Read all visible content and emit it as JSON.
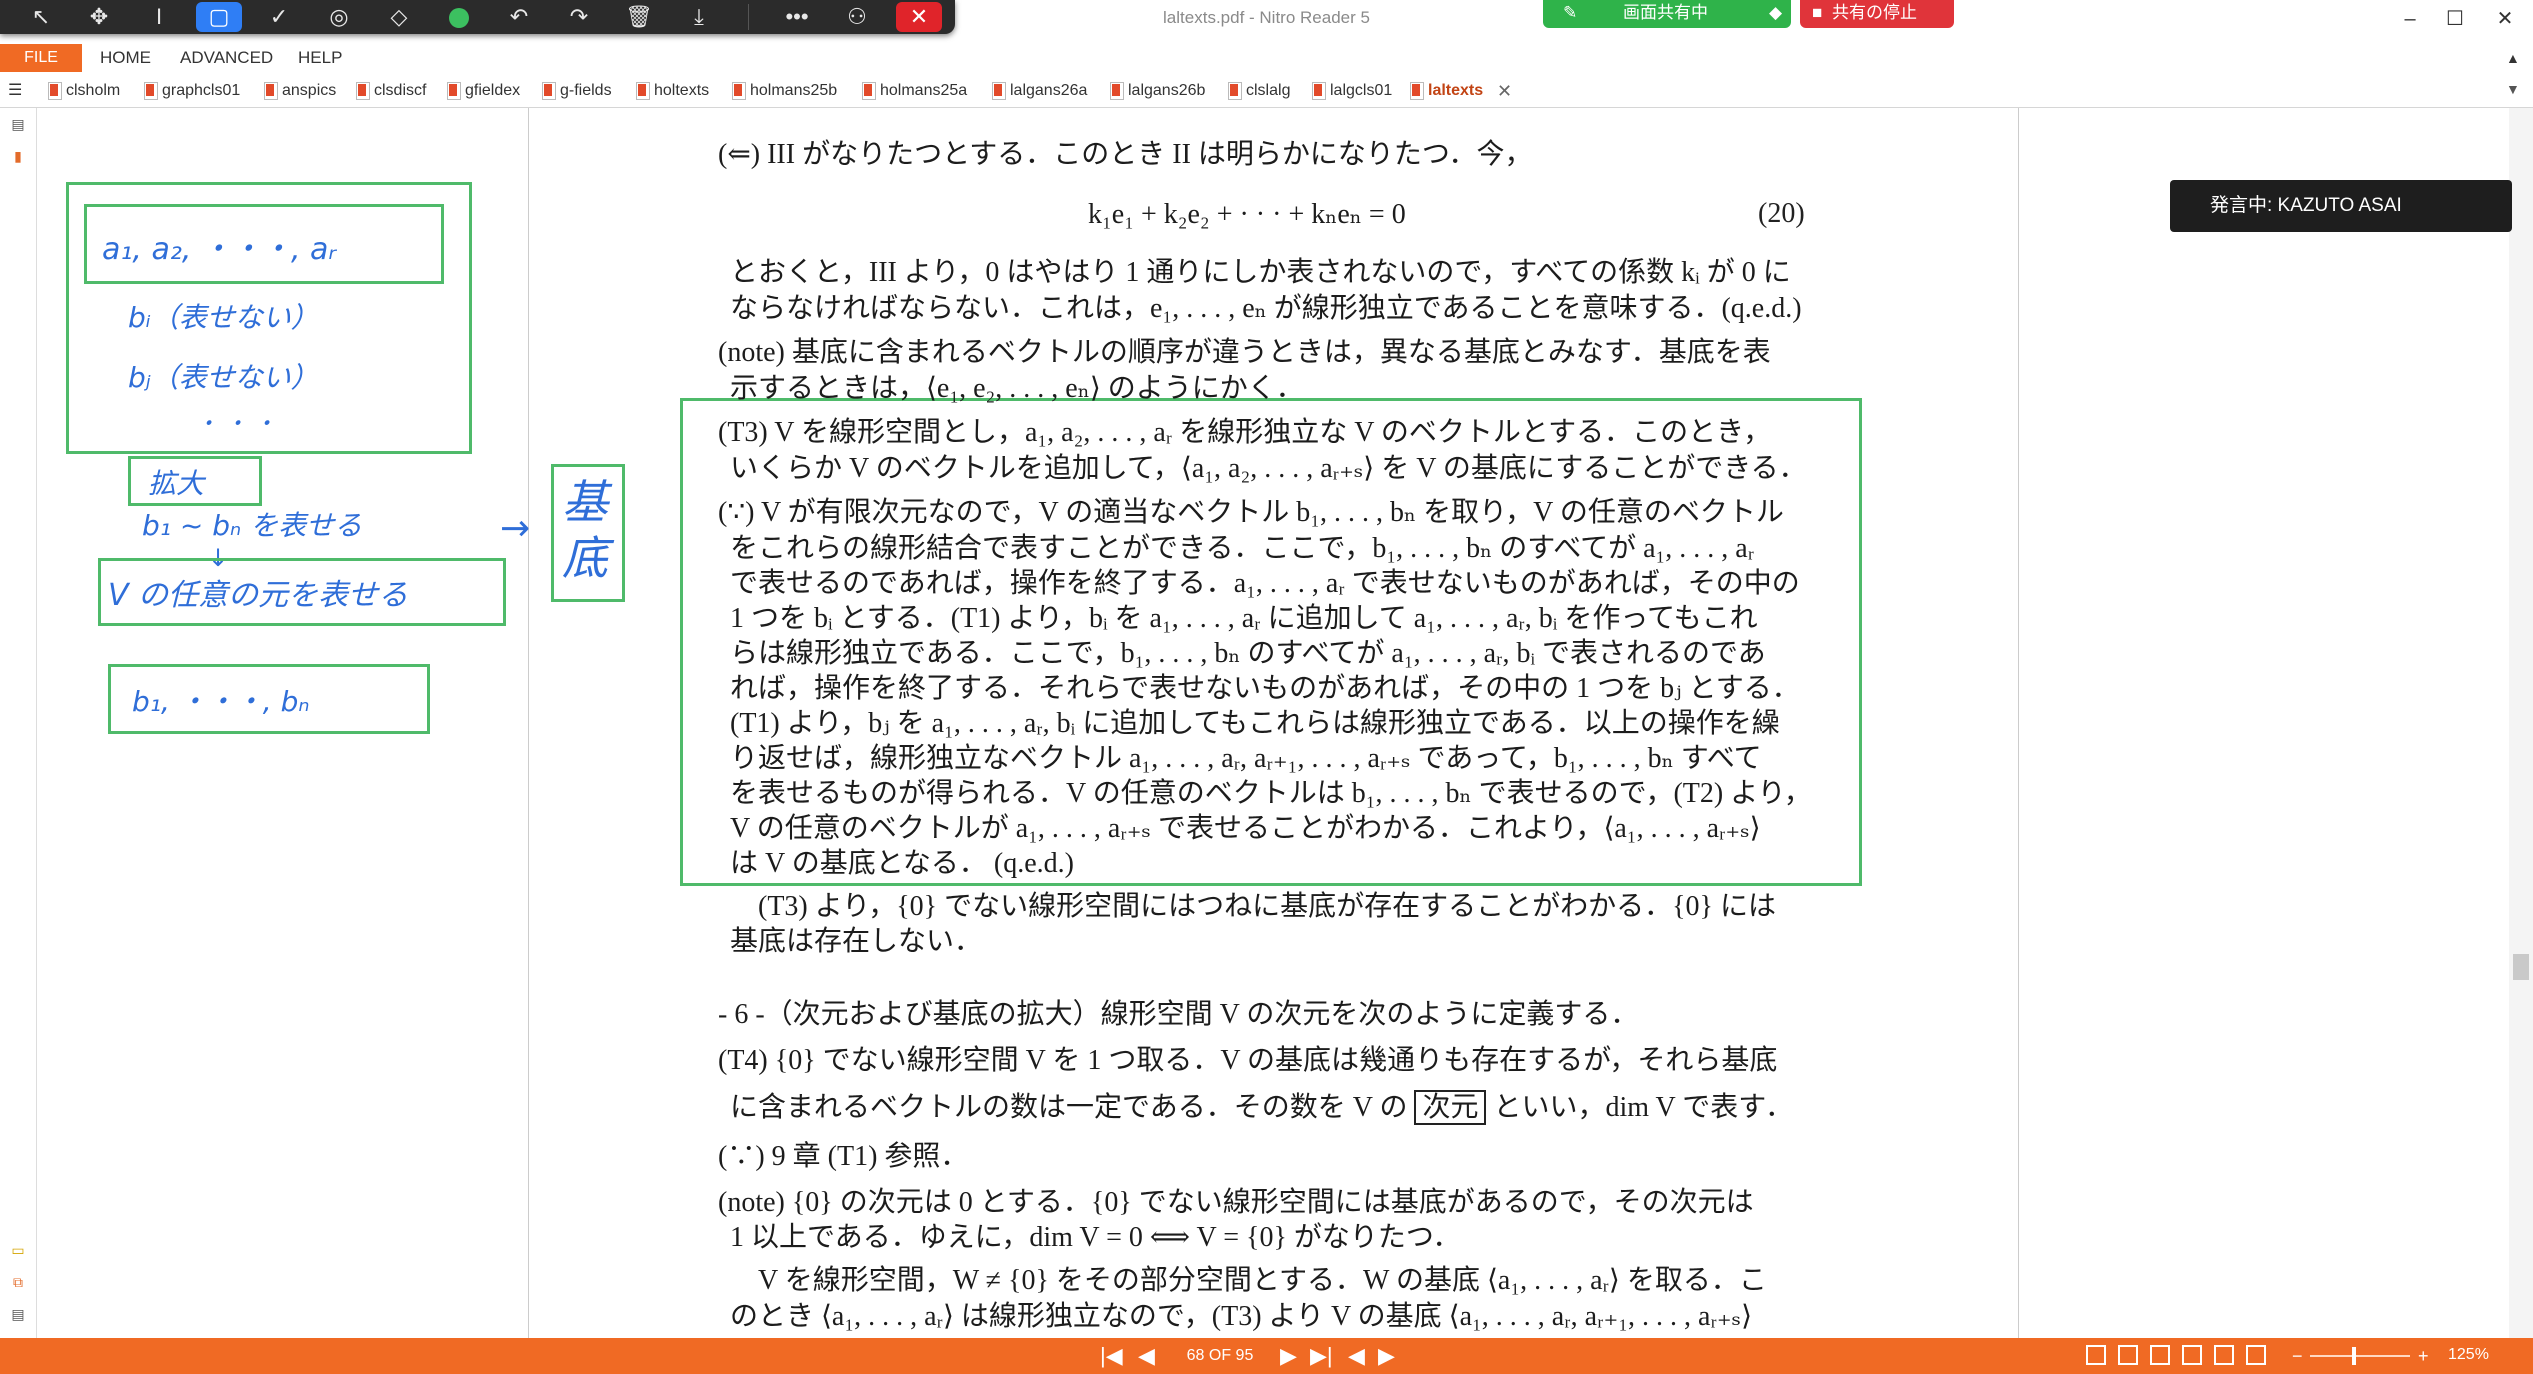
{
  "window": {
    "title": "laltexts.pdf - Nitro Reader 5",
    "controls": [
      "–",
      "☐",
      "✕"
    ]
  },
  "annotation_toolbar": {
    "tools": [
      {
        "name": "pointer-tool",
        "glyph": "↖"
      },
      {
        "name": "move-tool",
        "glyph": "✥"
      },
      {
        "name": "text-tool",
        "glyph": "I"
      },
      {
        "name": "rectangle-tool",
        "glyph": "▢"
      },
      {
        "name": "check-tool",
        "glyph": "✓"
      },
      {
        "name": "stamp-tool",
        "glyph": "◎"
      },
      {
        "name": "eraser-tool",
        "glyph": "◇"
      },
      {
        "name": "color-tool",
        "glyph": ""
      },
      {
        "name": "undo-tool",
        "glyph": "↶"
      },
      {
        "name": "redo-tool",
        "glyph": "↷"
      },
      {
        "name": "delete-tool",
        "glyph": "🗑"
      },
      {
        "name": "save-tool",
        "glyph": "⤓"
      },
      {
        "name": "more-tool",
        "glyph": "•••"
      },
      {
        "name": "participant-tool",
        "glyph": "⚇"
      },
      {
        "name": "close-tool",
        "glyph": "✕"
      }
    ]
  },
  "share": {
    "active_label": "画面共有中",
    "stop_label": "共有の停止"
  },
  "menu": {
    "file": "FILE",
    "items": [
      "HOME",
      "ADVANCED",
      "HELP"
    ]
  },
  "tabs": [
    "clsholm",
    "graphcls01",
    "anspics",
    "clsdiscf",
    "gfieldex",
    "g-fields",
    "holtexts",
    "holmans25b",
    "holmans25a",
    "lalgans26a",
    "lalgans26b",
    "clslalg",
    "lalgcls01",
    "laltexts"
  ],
  "speaking": "発言中: KAZUTO ASAI",
  "document": {
    "lines": [
      "(⇐) III がなりたつとする．このとき II は明らかになりたつ．今，",
      "k₁e₁ + k₂e₂ + · · · + kₙeₙ = 0",
      "とおくと，III より，0 はやはり 1 通りにしか表されないので，すべての係数 kᵢ が 0 に",
      "ならなければならない．これは，e₁, . . . , eₙ が線形独立であることを意味する．(q.e.d.)",
      "(note) 基底に含まれるベクトルの順序が違うときは，異なる基底とみなす．基底を表",
      "示するときは，⟨e₁, e₂, . . . , eₙ⟩ のようにかく．",
      "(T3) V を線形空間とし，a₁, a₂, . . . , aᵣ を線形独立な V のベクトルとする．このとき，",
      "いくらか V のベクトルを追加して，⟨a₁, a₂, . . . , aᵣ₊ₛ⟩ を V の基底にすることができる．",
      "(∵) V が有限次元なので，V の適当なベクトル b₁, . . . , bₙ を取り，V の任意のベクトル",
      "をこれらの線形結合で表すことができる．ここで，b₁, . . . , bₙ のすべてが a₁, . . . , aᵣ",
      "で表せるのであれば，操作を終了する．a₁, . . . , aᵣ で表せないものがあれば，その中の",
      "1 つを bᵢ とする．(T1) より，bᵢ を a₁, . . . , aᵣ に追加して a₁, . . . , aᵣ, bᵢ を作ってもこれ",
      "らは線形独立である．ここで，b₁, . . . , bₙ のすべてが a₁, . . . , aᵣ, bᵢ で表されるのであ",
      "れば，操作を終了する．それらで表せないものがあれば，その中の 1 つを bⱼ とする．",
      "(T1) より，bⱼ を a₁, . . . , aᵣ, bᵢ に追加してもこれらは線形独立である．以上の操作を繰",
      "り返せば，線形独立なベクトル a₁, . . . , aᵣ, aᵣ₊₁, . . . , aᵣ₊ₛ であって，b₁, . . . , bₙ すべて",
      "を表せるものが得られる．V の任意のベクトルは b₁, . . . , bₙ で表せるので，(T2) より，",
      "V の任意のベクトルが a₁, . . . , aᵣ₊ₛ で表せることがわかる．これより，⟨a₁, . . . , aᵣ₊ₛ⟩",
      "は V の基底となる．  (q.e.d.)",
      "(T3) より，{0} でない線形空間にはつねに基底が存在することがわかる．{0} には",
      "基底は存在しない．",
      "- 6 -（次元および基底の拡大）線形空間 V の次元を次のように定義する．",
      "(T4) {0} でない線形空間 V を 1 つ取る．V の基底は幾通りも存在するが，それら基底",
      "(∵) 9 章 (T1) 参照．",
      "(note) {0} の次元は 0 とする．{0} でない線形空間には基底があるので，その次元は",
      "1 以上である．ゆえに，dim V = 0  ⟺  V = {0} がなりたつ．",
      "V を線形空間，W ≠ {0} をその部分空間とする．W の基底 ⟨a₁, . . . , aᵣ⟩ を取る．こ",
      "のとき ⟨a₁, . . . , aᵣ⟩ は線形独立なので，(T3) より V の基底 ⟨a₁, . . . , aᵣ, aᵣ₊₁, . . . , aᵣ₊ₛ⟩"
    ],
    "equation_number": "(20)",
    "t4_line_prefix": "に含まれるベクトルの数は一定である．その数を V の",
    "boxed_term": "次元",
    "t4_line_suffix": "といい，dim V で表す．"
  },
  "handwriting": {
    "box1_line": "a₁, a₂, ・・・, aᵣ",
    "note_b_i": "bᵢ（表せない）",
    "note_b_j": "bⱼ（表せない）",
    "dots": "・ ・ ・",
    "kakudai": "拡大",
    "b_span": "b₁ ~ bₙ を表せる",
    "v_any": "V の任意の元を表せる",
    "b_list": "b₁, ・・・, bₙ",
    "kitei": "基底",
    "arrow": "→"
  },
  "status": {
    "page": "68 OF 95",
    "zoom": "125%",
    "nav": [
      "|◀",
      "◀",
      "▶",
      "▶|",
      "◀",
      "▶"
    ],
    "zoom_minus": "−",
    "zoom_plus": "+"
  }
}
